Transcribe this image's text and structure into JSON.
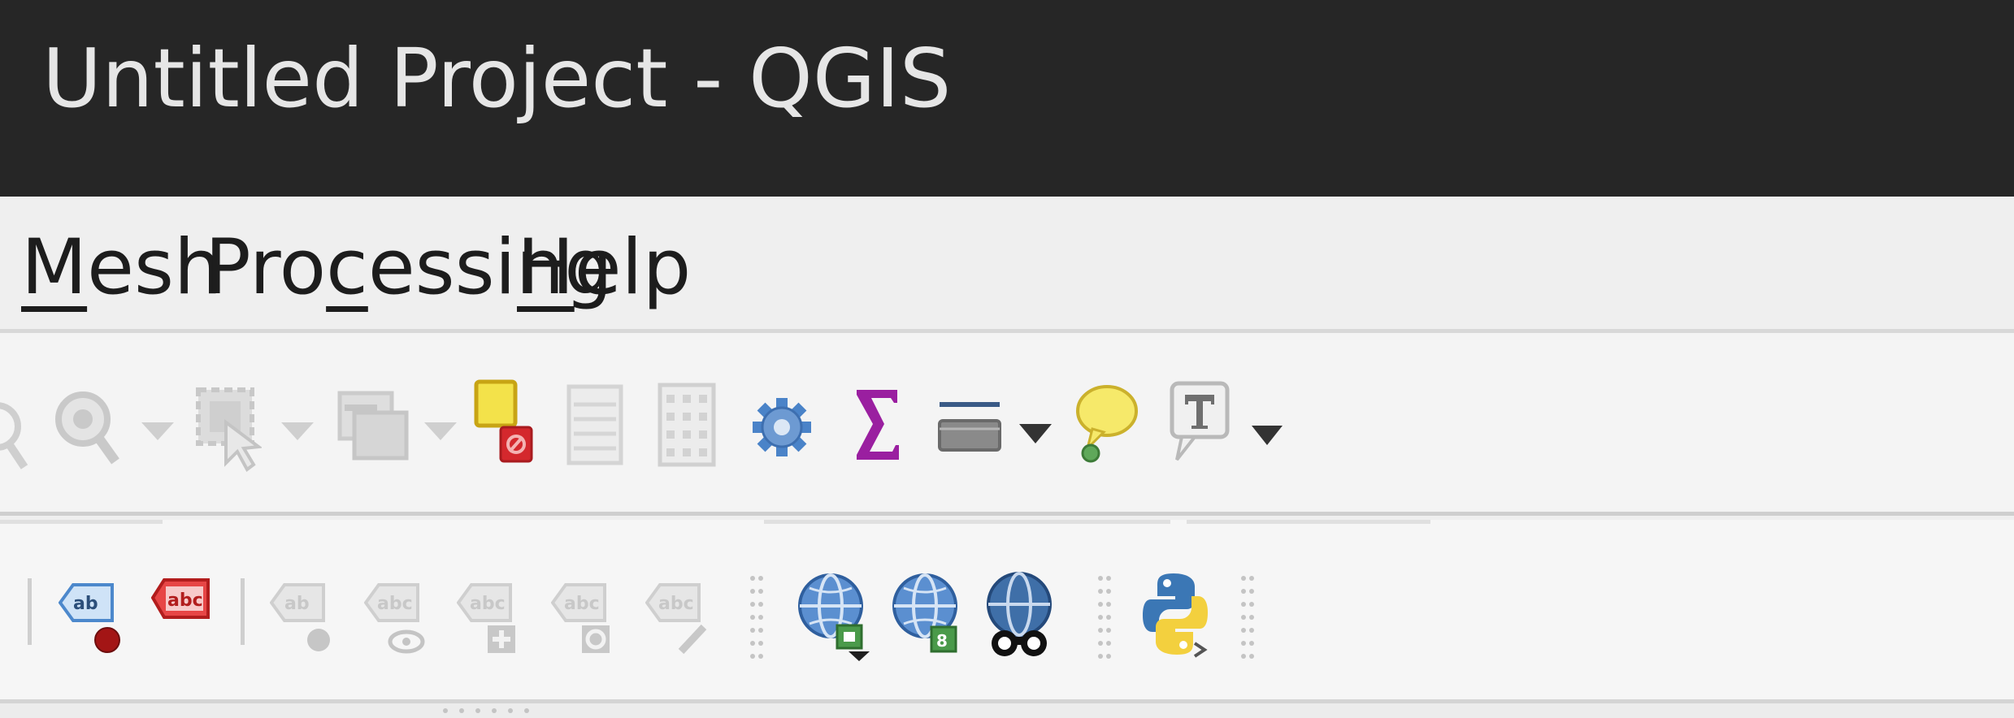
{
  "window": {
    "title": "Untitled Project - QGIS"
  },
  "menubar": {
    "items": [
      {
        "pre": "",
        "mnemonic": "M",
        "rest": "esh"
      },
      {
        "pre": "Pro",
        "mnemonic": "c",
        "rest": "essing"
      },
      {
        "pre": "",
        "mnemonic": "H",
        "rest": "elp"
      }
    ]
  },
  "toolbar_attributes": {
    "icons": [
      "identify-features-icon",
      "open-table-zoom-icon",
      "select-features-icon",
      "deselect-icon",
      "select-by-expression-icon",
      "open-attribute-table-icon",
      "open-field-calculator-icon",
      "processing-toolbox-gear-icon",
      "show-statistical-summary-sigma-icon",
      "measure-line-icon",
      "map-tips-icon",
      "text-annotation-icon"
    ]
  },
  "toolbar_labels": {
    "icons": [
      "layer-labeling-options-icon",
      "layer-diagram-options-icon",
      "pin-unpin-labels-icon",
      "highlight-pinned-labels-icon",
      "show-hide-labels-icon",
      "move-label-icon",
      "rotate-label-icon",
      "change-label-properties-icon",
      "add-wms-layer-icon",
      "add-wcs-layer-icon",
      "metasearch-icon",
      "python-console-icon"
    ]
  },
  "colors": {
    "titlebar": "#262626",
    "title_text": "#e6e6e6",
    "menubar": "#efefef",
    "toolbar_bg": "#f4f4f4",
    "accent_blue": "#4a7fc1",
    "sigma_purple": "#9a1fa0",
    "label_red": "#d22d2d",
    "note_yellow": "#f6e96a"
  }
}
